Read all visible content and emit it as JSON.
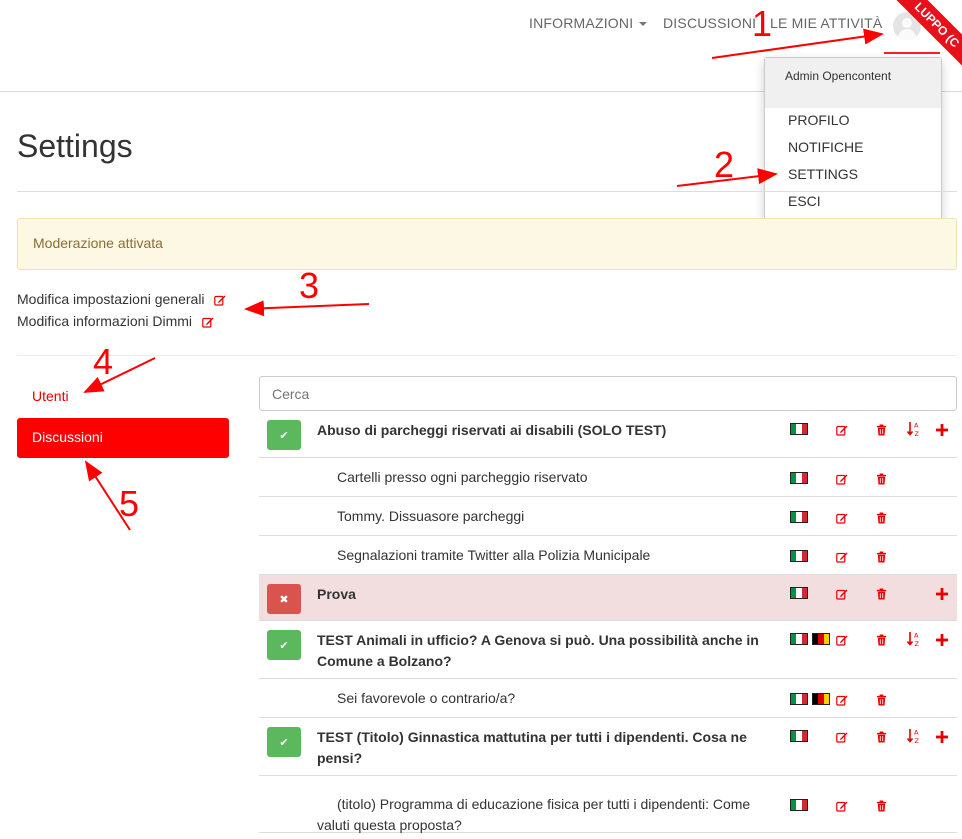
{
  "header": {
    "nav": [
      {
        "label": "INFORMAZIONI",
        "has_caret": true
      },
      {
        "label": "DISCUSSIONI"
      },
      {
        "label": "LE MIE ATTIVITÀ"
      }
    ],
    "ribbon": "LUPPO (C"
  },
  "user_menu": {
    "user_name": "Admin Opencontent",
    "items": [
      "PROFILO",
      "NOTIFICHE",
      "SETTINGS",
      "ESCI"
    ]
  },
  "page": {
    "title": "Settings",
    "alert": "Moderazione attivata",
    "links": [
      "Modifica impostazioni generali",
      "Modifica informazioni Dimmi"
    ]
  },
  "sidebar": {
    "items": [
      {
        "label": "Utenti",
        "active": false
      },
      {
        "label": "Discussioni",
        "active": true
      }
    ]
  },
  "search": {
    "placeholder": "Cerca"
  },
  "annotations": [
    "1",
    "2",
    "3",
    "4",
    "5"
  ],
  "table": {
    "rows": [
      {
        "title": "Abuso di parcheggi riservati ai disabili (SOLO TEST)",
        "level": 0,
        "status": "approved",
        "languages": [
          "it"
        ],
        "sortable": true,
        "addable": true
      },
      {
        "title": "Cartelli presso ogni parcheggio riservato",
        "level": 1,
        "languages": [
          "it"
        ]
      },
      {
        "title": "Tommy. Dissuasore parcheggi",
        "level": 1,
        "languages": [
          "it"
        ]
      },
      {
        "title": "Segnalazioni tramite Twitter alla Polizia Municipale",
        "level": 1,
        "languages": [
          "it"
        ]
      },
      {
        "title": "Prova",
        "level": 0,
        "status": "rejected",
        "languages": [
          "it"
        ],
        "sortable": false,
        "addable": true
      },
      {
        "title": "TEST Animali in ufficio? A Genova si può. Una possibilità anche in Comune a Bolzano?",
        "level": 0,
        "status": "approved",
        "languages": [
          "it",
          "de"
        ],
        "sortable": true,
        "addable": true
      },
      {
        "title": "Sei favorevole o contrario/a?",
        "level": 1,
        "languages": [
          "it",
          "de"
        ]
      },
      {
        "title": "TEST (Titolo) Ginnastica mattutina per tutti i dipendenti. Cosa ne pensi?",
        "level": 0,
        "status": "approved",
        "languages": [
          "it"
        ],
        "sortable": true,
        "addable": true
      },
      {
        "title": "(titolo) Programma di educazione fisica per tutti i dipendenti: Come valuti questa proposta?",
        "level": 1,
        "languages": [
          "it"
        ]
      }
    ]
  },
  "colors": {
    "accent": "#ff0000",
    "approved": "#5cb85c",
    "rejected": "#d9534f",
    "alert_bg": "#fcf8e3",
    "alert_text": "#8a6d3b",
    "annotation": "#ff0000"
  }
}
